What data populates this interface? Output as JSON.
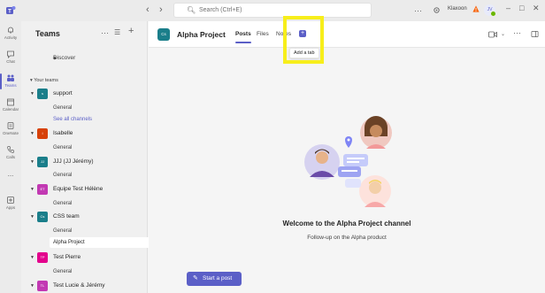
{
  "titlebar": {
    "back": "‹",
    "forward": "›",
    "search_placeholder": "Search (Ctrl+E)",
    "more": "···",
    "user_name": "Klaxoon",
    "avatar_initials": "JV",
    "minimize": "–",
    "maximize": "□",
    "close": "✕"
  },
  "rail": [
    {
      "label": "Activity",
      "icon": "bell-icon"
    },
    {
      "label": "Chat",
      "icon": "chat-icon"
    },
    {
      "label": "Teams",
      "icon": "teams-icon"
    },
    {
      "label": "Calendar",
      "icon": "calendar-icon"
    },
    {
      "label": "OneNote",
      "icon": "onenote-icon"
    },
    {
      "label": "Calls",
      "icon": "phone-icon"
    },
    {
      "label": "...",
      "icon": "more-icon"
    },
    {
      "label": "Apps",
      "icon": "apps-icon"
    }
  ],
  "pane": {
    "title": "Teams",
    "more": "···",
    "filter": "☰",
    "add": "+",
    "discover": "Discover",
    "section_label": "Your teams",
    "teams": [
      {
        "initials": "s",
        "name": "support",
        "color": "#1a7e8a",
        "channels": [
          "General",
          "See all channels"
        ]
      },
      {
        "initials": "I",
        "name": "Isabelle",
        "color": "#d74108",
        "channels": [
          "General"
        ]
      },
      {
        "initials": "JJ",
        "name": "JJJ (JJ Jérémy)",
        "color": "#1a7e8a",
        "channels": [
          "General"
        ]
      },
      {
        "initials": "ET",
        "name": "Equipe Test Hélène",
        "color": "#c239b3",
        "channels": [
          "General"
        ]
      },
      {
        "initials": "Cs",
        "name": "CSS team",
        "color": "#1a7e8a",
        "channels": [
          "General",
          "Alpha Project"
        ]
      },
      {
        "initials": "TP",
        "name": "Test Pierre",
        "color": "#e3008c",
        "channels": [
          "General"
        ]
      },
      {
        "initials": "TL",
        "name": "Test Lucie & Jérémy",
        "color": "#c239b3",
        "channels": []
      }
    ]
  },
  "channel": {
    "avatar_initials": "Cs",
    "title": "Alpha Project",
    "tabs": [
      "Posts",
      "Files",
      "Notes"
    ],
    "active_tab": "Posts",
    "add_tab_symbol": "+",
    "tooltip": "Add a tab",
    "welcome_title": "Welcome to the Alpha Project channel",
    "welcome_subtitle": "Follow-up on the Alpha product",
    "start_post": "Start a post"
  },
  "colors": {
    "accent": "#5b5fc7",
    "highlight": "#f7ee1b"
  }
}
